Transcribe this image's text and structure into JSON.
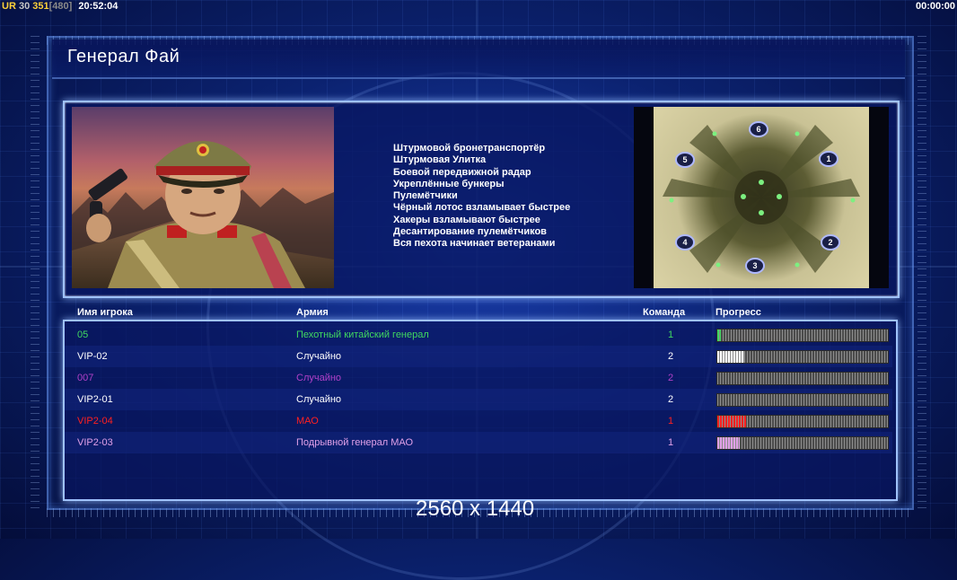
{
  "status_bar": {
    "tag": "UR",
    "num1": "30",
    "num2": "351",
    "num3": "[480]",
    "clock": "20:52:04",
    "timer": "00:00:00"
  },
  "page_title": "Генерал Фай",
  "general": {
    "traits": [
      "Штурмовой бронетранспортёр",
      "Штурмовая Улитка",
      "Боевой передвижной радар",
      "Укреплённые бункеры",
      "Пулемётчики",
      "Чёрный лотос взламывает быстрее",
      "Хакеры взламывают быстрее",
      "Десантирование пулемётчиков",
      "Вся пехота начинает ветеранами"
    ]
  },
  "map": {
    "start_positions": [
      "1",
      "2",
      "3",
      "4",
      "5",
      "6"
    ]
  },
  "players_table": {
    "headers": {
      "name": "Имя игрока",
      "army": "Армия",
      "team": "Команда",
      "progress": "Прогресс"
    },
    "rows": [
      {
        "name": "05",
        "army": "Пехотный китайский генерал",
        "team": "1",
        "color": "#40d860",
        "progress": 0.02
      },
      {
        "name": "VIP-02",
        "army": "Случайно",
        "team": "2",
        "color": "#ffffff",
        "progress": 0.16
      },
      {
        "name": "007",
        "army": "Случайно",
        "team": "2",
        "color": "#b040c8",
        "progress": 0.0
      },
      {
        "name": "VIP2-01",
        "army": "Случайно",
        "team": "2",
        "color": "#ffffff",
        "progress": 0.0
      },
      {
        "name": "VIP2-04",
        "army": "МАО",
        "team": "1",
        "color": "#ff2020",
        "progress": 0.17
      },
      {
        "name": "VIP2-03",
        "army": "Подрывной генерал МАО",
        "team": "1",
        "color": "#e0a0e8",
        "progress": 0.13
      }
    ]
  },
  "resolution": "2560 x 1440"
}
